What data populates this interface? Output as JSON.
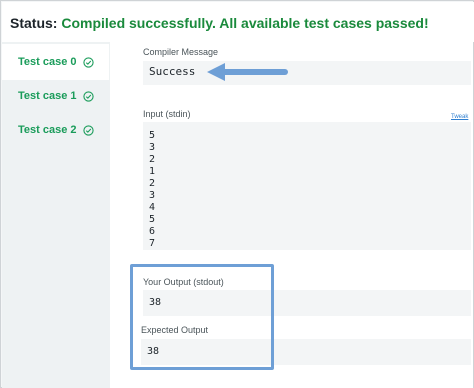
{
  "status": {
    "label": "Status:",
    "message": "Compiled successfully. All available test cases passed!"
  },
  "sidebar": {
    "tabs": [
      {
        "label": "Test case 0",
        "icon": "check-circle-icon",
        "active": true
      },
      {
        "label": "Test case 1",
        "icon": "check-circle-icon",
        "active": false
      },
      {
        "label": "Test case 2",
        "icon": "check-circle-icon",
        "active": false
      }
    ]
  },
  "compiler": {
    "label": "Compiler Message",
    "value": "Success"
  },
  "input": {
    "label": "Input (stdin)",
    "link": "Tweak",
    "lines": [
      "5",
      "3",
      "2",
      "1",
      "2",
      "3",
      "4",
      "5",
      "6",
      "7"
    ]
  },
  "output": {
    "label": "Your Output (stdout)",
    "value": "38"
  },
  "expected": {
    "label": "Expected Output",
    "value": "38"
  },
  "colors": {
    "success": "#1a8a3c",
    "tab_text": "#1a9c5a",
    "annotation": "#6e9fd6"
  }
}
